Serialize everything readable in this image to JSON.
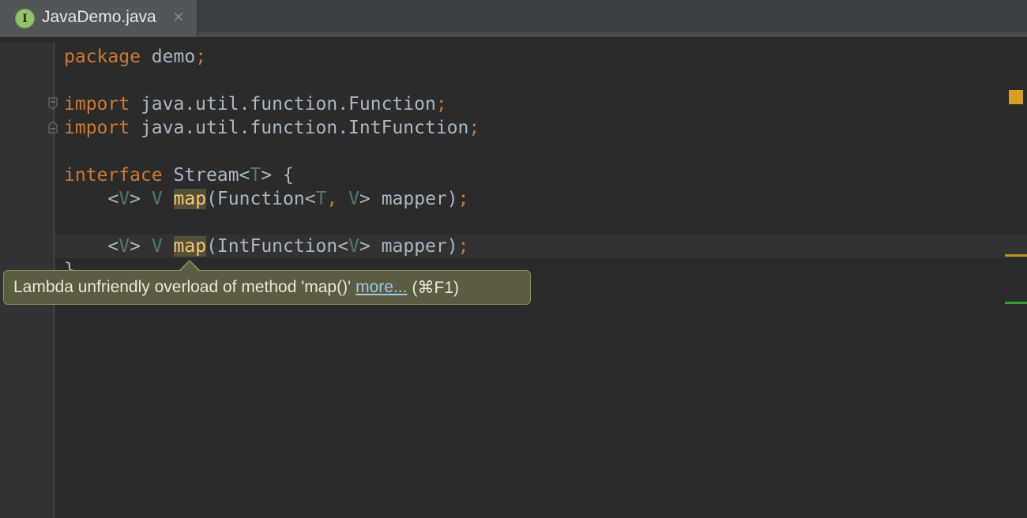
{
  "tab": {
    "icon_letter": "I",
    "icon": "interface-icon",
    "title": "JavaDemo.java",
    "close": "×"
  },
  "code": {
    "line1": {
      "kw": "package",
      "rest": " demo",
      "semi": ";"
    },
    "line3": {
      "kw": "import",
      "rest": " java.util.function.Function",
      "semi": ";"
    },
    "line4": {
      "kw": "import",
      "rest": " java.util.function.IntFunction",
      "semi": ";"
    },
    "line6": {
      "kw": "interface",
      "name": " Stream<",
      "tp": "T",
      "end": "> {"
    },
    "line7": {
      "a": "    <",
      "tp1": "V",
      "b": "> ",
      "tp2": "V",
      "c": " ",
      "method": "map",
      "d": "(Function<",
      "tp3": "T",
      "comma": ",",
      "e": " ",
      "tp4": "V",
      "f": "> mapper)",
      "semi": ";"
    },
    "line9": {
      "a": "    <",
      "tp1": "V",
      "b": "> ",
      "tp2": "V",
      "c": " ",
      "method": "map",
      "d": "(IntFunction<",
      "tp3": "V",
      "f": "> mapper)",
      "semi": ";"
    },
    "line10": "}"
  },
  "tooltip": {
    "message": "Lambda unfriendly overload of method 'map()'",
    "link": "more...",
    "shortcut": "(⌘F1)"
  },
  "colors": {
    "keyword": "#cc7832",
    "type_param": "#507874",
    "method_highlight": "#ffc66d",
    "warning_marker": "#d9a020",
    "ok_marker": "#32a032"
  }
}
